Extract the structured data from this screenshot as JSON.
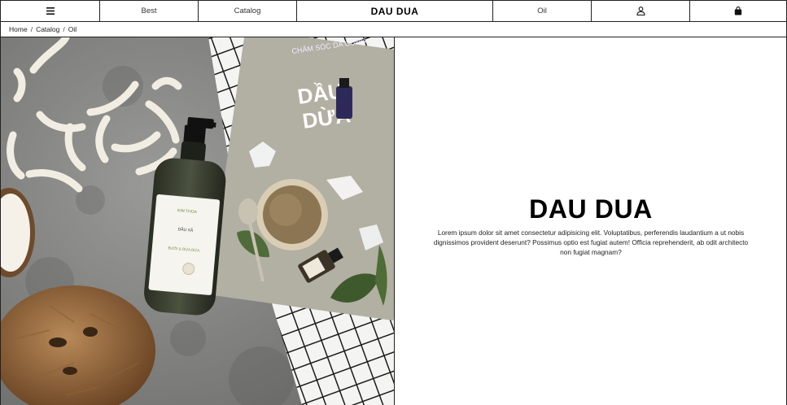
{
  "nav": {
    "best_label": "Best",
    "catalog_label": "Catalog",
    "brand": "DAU DUA",
    "oil_label": "Oil",
    "icons": {
      "menu": "hamburger-menu-icon",
      "user": "user-icon",
      "cart": "shopping-bag-icon"
    }
  },
  "breadcrumb": {
    "items": [
      "Home",
      "Catalog",
      "Oil"
    ],
    "separator": "/"
  },
  "hero": {
    "title": "DAU DUA",
    "description": "Lorem ipsum dolor sit amet consectetur adipisicing elit. Voluptatibus, perferendis laudantium a ut nobis dignissimos provident deserunt? Possimus optio est fugiat autem! Officia reprehenderit, ab odit architecto non fugiat magnam?",
    "image": {
      "magazine_heading_small": "CHĂM SÓC DA CÙNG",
      "magazine_heading_big_1": "DẦU",
      "magazine_heading_big_2": "DỪA",
      "bottle_brand": "KIM THOA",
      "bottle_line1": "DẦU XẢ",
      "bottle_line2": "BƯỞI & DỪA DỪA"
    }
  }
}
